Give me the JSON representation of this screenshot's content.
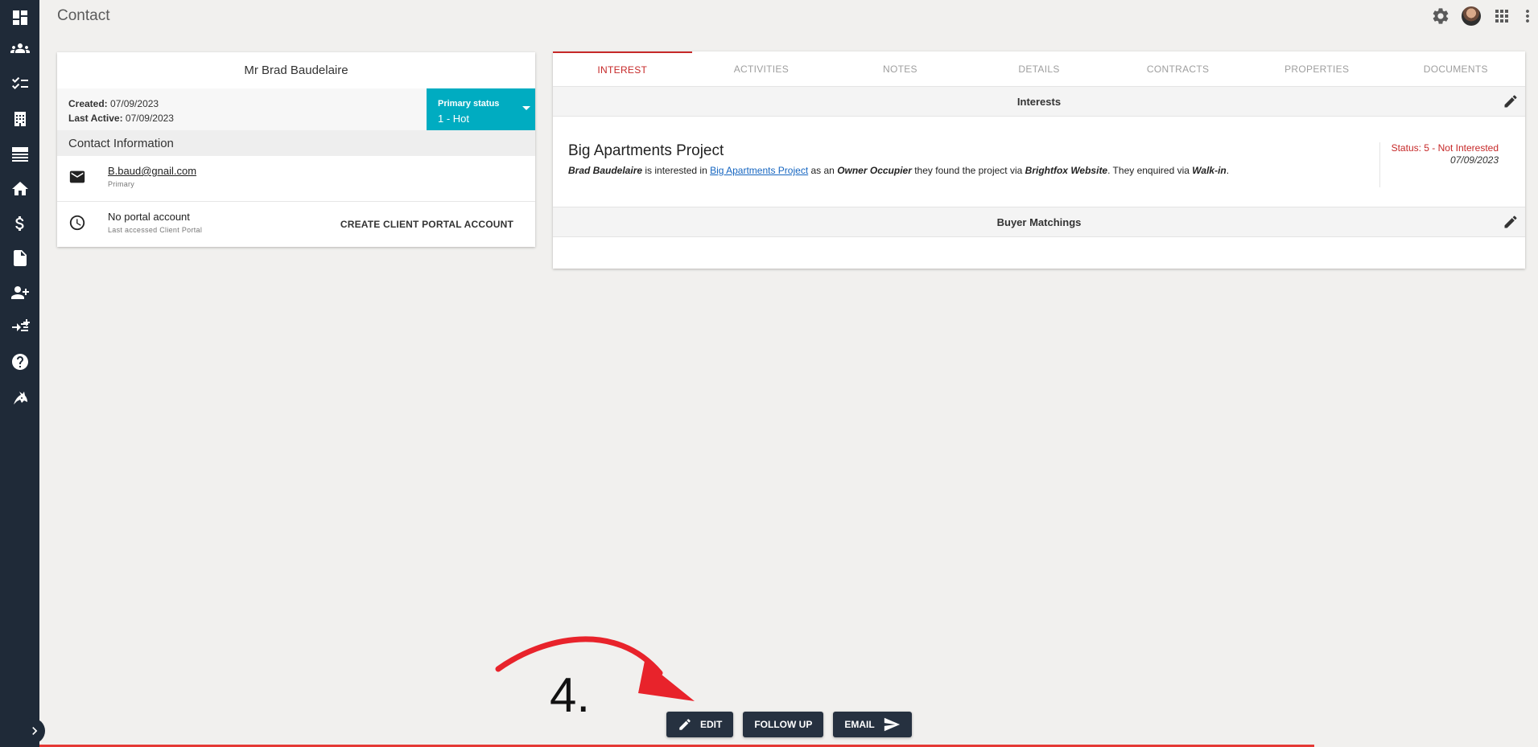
{
  "header": {
    "title": "Contact"
  },
  "sidebar": {
    "items": [
      {
        "icon": "dashboard-icon"
      },
      {
        "icon": "contacts-icon"
      },
      {
        "icon": "tasks-list-icon"
      },
      {
        "icon": "building-icon"
      },
      {
        "icon": "list-icon"
      },
      {
        "icon": "home-icon"
      },
      {
        "icon": "dollar-icon"
      },
      {
        "icon": "document-icon"
      },
      {
        "icon": "add-person-icon"
      },
      {
        "icon": "add-task-icon"
      },
      {
        "icon": "help-icon"
      },
      {
        "icon": "brightfox-logo-icon"
      }
    ]
  },
  "contact": {
    "name": "Mr Brad Baudelaire",
    "created_label": "Created:",
    "created": "07/09/2023",
    "last_active_label": "Last Active:",
    "last_active": "07/09/2023",
    "primary_status_label": "Primary status",
    "primary_status_value": "1 - Hot",
    "info_header": "Contact Information",
    "email": "B.baud@gnail.com",
    "email_sub": "Primary",
    "portal": "No portal account",
    "portal_sub": "Last accessed Client Portal",
    "portal_button": "CREATE CLIENT PORTAL ACCOUNT"
  },
  "tabs": [
    "INTEREST",
    "ACTIVITIES",
    "NOTES",
    "DETAILS",
    "CONTRACTS",
    "PROPERTIES",
    "DOCUMENTS"
  ],
  "interests": {
    "header": "Interests",
    "project_title": "Big Apartments Project",
    "person": "Brad Baudelaire",
    "text1": " is interested in ",
    "project_link": "Big Apartments Project",
    "text2": " as an ",
    "role": "Owner Occupier",
    "text3": " they found the project via ",
    "source": "Brightfox Website",
    "text4": ". They enquired via ",
    "method": "Walk-in",
    "text5": ".",
    "status": "Status: 5 - Not Interested",
    "date": "07/09/2023"
  },
  "buyer_matchings": {
    "header": "Buyer Matchings"
  },
  "annotation": {
    "number": "4."
  },
  "actions": {
    "edit": "EDIT",
    "follow_up": "FOLLOW UP",
    "email": "EMAIL"
  },
  "colors": {
    "sidebar": "#1f2a38",
    "accent_teal": "#00acc1",
    "accent_red": "#c62828",
    "button_dark": "#263140"
  }
}
